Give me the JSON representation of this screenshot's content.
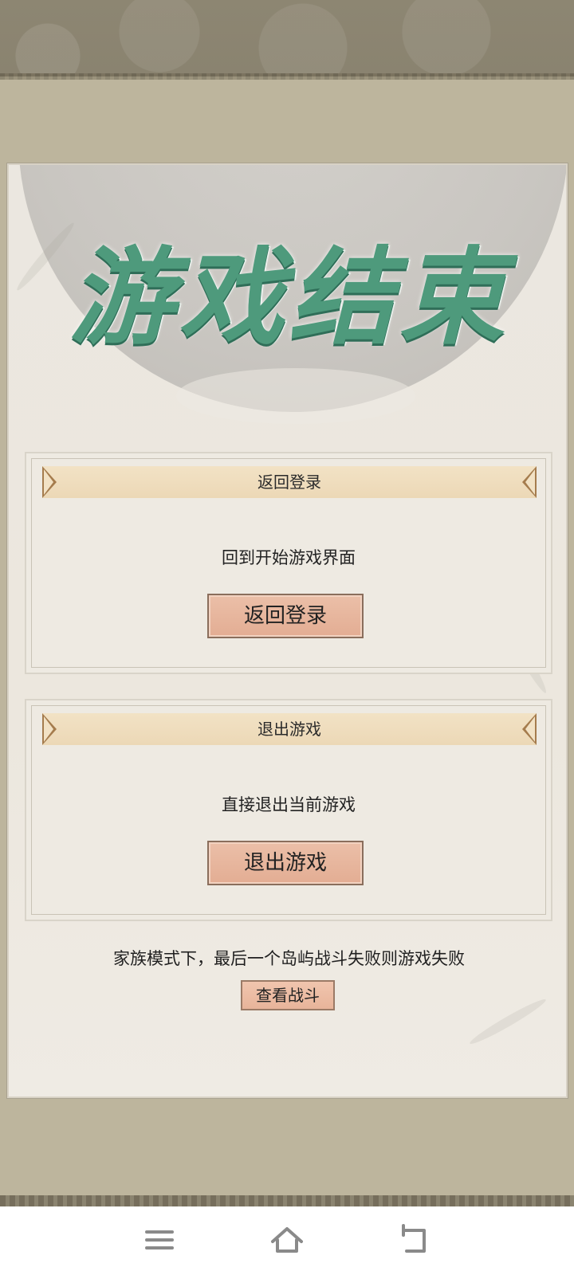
{
  "title": "游戏结束",
  "cards": [
    {
      "banner_label": "返回登录",
      "description": "回到开始游戏界面",
      "button_label": "返回登录"
    },
    {
      "banner_label": "退出游戏",
      "description": "直接退出当前游戏",
      "button_label": "退出游戏"
    }
  ],
  "footnote": "家族模式下，最后一个岛屿战斗失败则游戏失败",
  "view_battle_label": "查看战斗",
  "navbar": {
    "menu_icon": "menu-icon",
    "home_icon": "home-icon",
    "back_icon": "back-icon"
  },
  "colors": {
    "title": "#4e9a7c",
    "button": "#e3ad93",
    "banner": "#f2e2c5"
  }
}
